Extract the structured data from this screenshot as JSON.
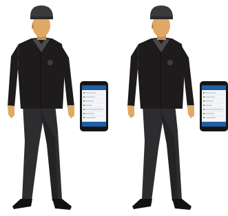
{
  "colors": {
    "background": "#ffffff",
    "skin": "#e0a866",
    "skin_shadow": "#c98c4a",
    "hair": "#b07a3c",
    "cap": "#3a3a3c",
    "jacket": "#1e1b1c",
    "jacket_seam": "#0e0c0d",
    "collar_undershirt": "#4a4a4c",
    "pants": "#2d2d2f",
    "pants_shadow": "#232325",
    "shoes": "#121212",
    "badge": "#3c3c3e",
    "phone_body": "#151515",
    "phone_header": "#1f5fa6",
    "phone_screen": "#f4f6f8",
    "phone_row_line": "#d6dbe0",
    "phone_bottom_bar": "#1f5fa6",
    "checkbox_green": "#5aa64a"
  },
  "figures": [
    {
      "id": "security-guard-1",
      "phone": {
        "list_rows": 8
      }
    },
    {
      "id": "security-guard-2",
      "phone": {
        "list_rows": 8
      }
    }
  ]
}
